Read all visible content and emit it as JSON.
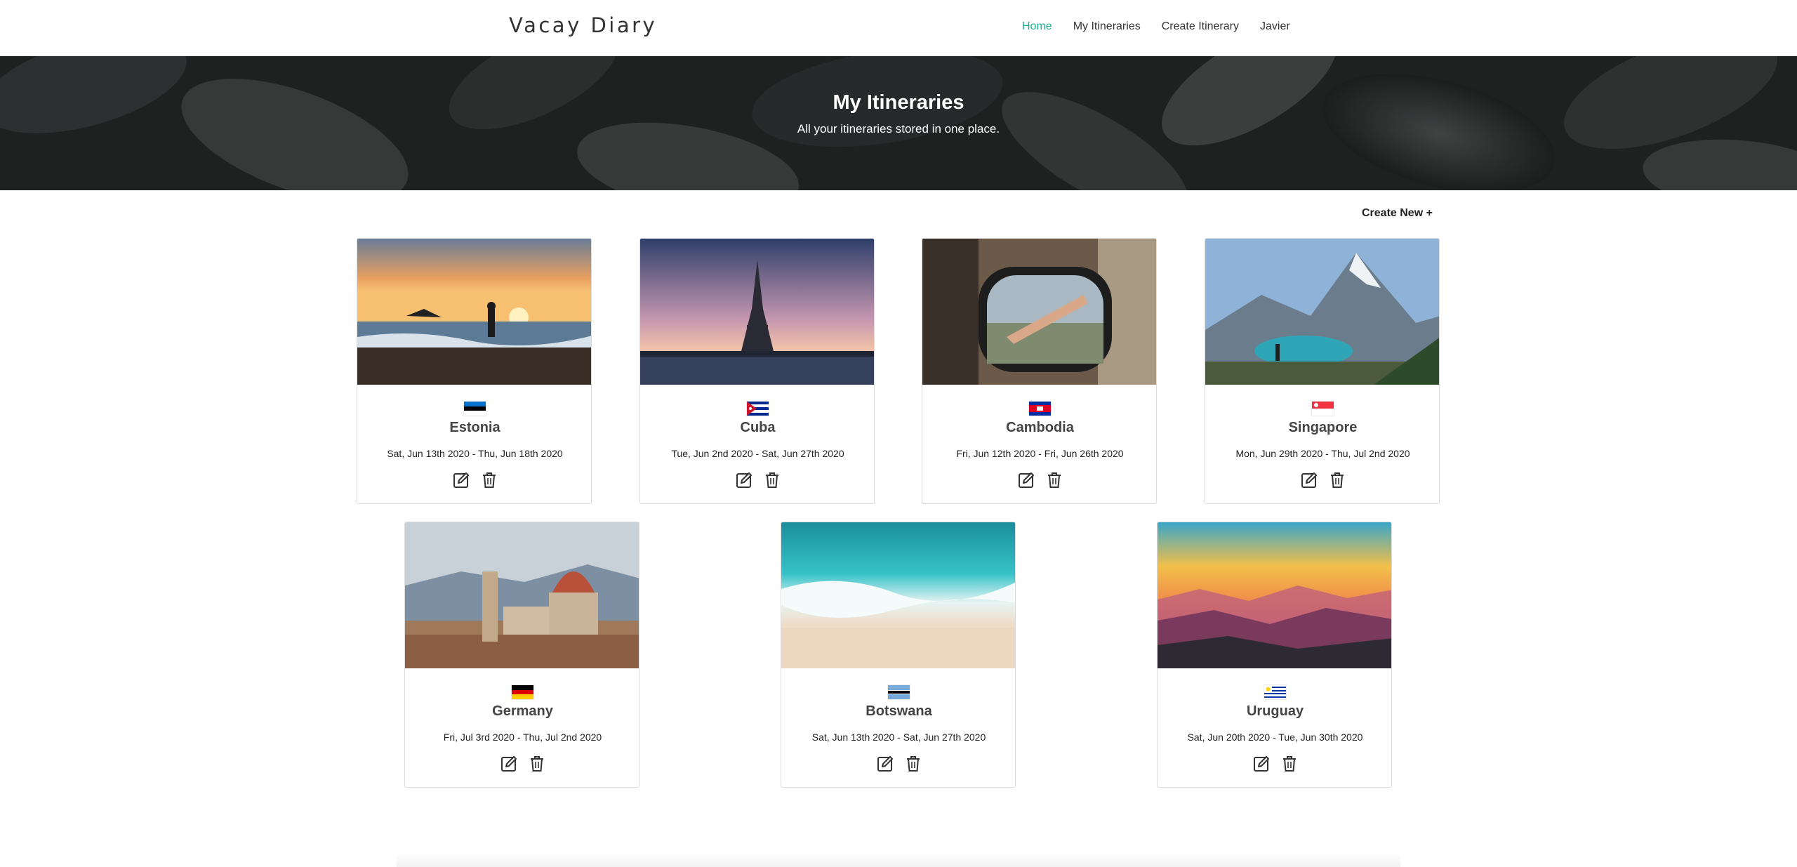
{
  "navbar": {
    "brand": "Vacay Diary",
    "links": [
      "Home",
      "My Itineraries",
      "Create Itinerary",
      "Javier"
    ]
  },
  "hero": {
    "title": "My Itineraries",
    "subtitle": "All your itineraries stored in one place."
  },
  "create_new_label": "Create New +",
  "cards": [
    {
      "country": "Estonia",
      "dates": "Sat, Jun 13th 2020 - Thu, Jun 18th 2020"
    },
    {
      "country": "Cuba",
      "dates": "Tue, Jun 2nd 2020 - Sat, Jun 27th 2020"
    },
    {
      "country": "Cambodia",
      "dates": "Fri, Jun 12th 2020 - Fri, Jun 26th 2020"
    },
    {
      "country": "Singapore",
      "dates": "Mon, Jun 29th 2020 - Thu, Jul 2nd 2020"
    },
    {
      "country": "Germany",
      "dates": "Fri, Jul 3rd 2020 - Thu, Jul 2nd 2020"
    },
    {
      "country": "Botswana",
      "dates": "Sat, Jun 13th 2020 - Sat, Jun 27th 2020"
    },
    {
      "country": "Uruguay",
      "dates": "Sat, Jun 20th 2020 - Tue, Jun 30th 2020"
    }
  ],
  "colors": {
    "accent": "#1eaf8f",
    "hero_bg": "#2c2f2f"
  },
  "icons": {
    "edit": "edit-icon",
    "delete": "trash-icon"
  }
}
